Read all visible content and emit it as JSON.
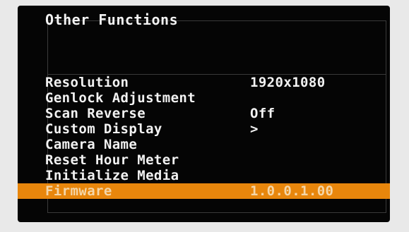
{
  "menu": {
    "title": "Other Functions",
    "items": [
      {
        "label": "Resolution",
        "value": "1920x1080"
      },
      {
        "label": "Genlock Adjustment",
        "value": ""
      },
      {
        "label": "Scan Reverse",
        "value": "Off"
      },
      {
        "label": "Custom Display",
        "value": ">"
      },
      {
        "label": "Camera Name",
        "value": ""
      },
      {
        "label": "Reset Hour Meter",
        "value": ""
      },
      {
        "label": "Initialize Media",
        "value": ""
      },
      {
        "label": "Firmware",
        "value": "1.0.0.1.00"
      }
    ],
    "selected_index": 7
  },
  "colors": {
    "screen_bg": "#050505",
    "text": "#f2f2f2",
    "highlight": "#e8860c",
    "highlight_text": "#f4d6a8"
  }
}
